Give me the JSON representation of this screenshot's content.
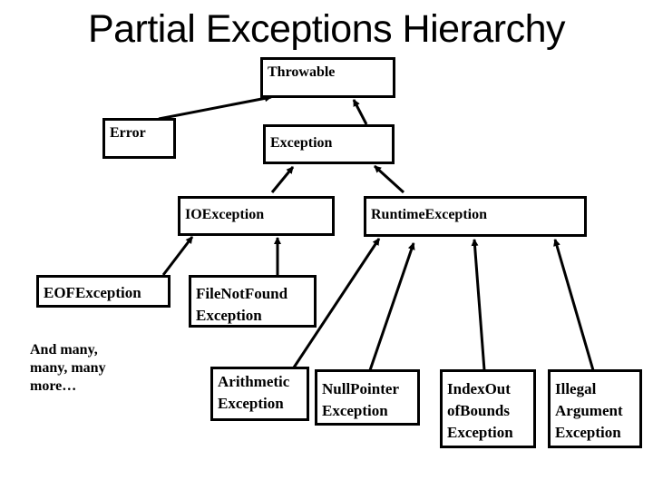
{
  "title": "Partial Exceptions Hierarchy",
  "nodes": {
    "throwable": "Throwable",
    "error": "Error",
    "exception": "Exception",
    "ioexception": "IOException",
    "runtimeexception": "RuntimeException",
    "eofexception": "EOFException",
    "filenotfound": "FileNotFound\nException",
    "arithmetic": "Arithmetic\nException",
    "nullpointer": "NullPointer\nException",
    "indexoutofbounds": "IndexOut\nofBounds\nException",
    "illegalargument": "Illegal\nArgument\nException"
  },
  "note": "And many,\nmany, many\nmore…",
  "edges": [
    {
      "from": "error",
      "to": "throwable"
    },
    {
      "from": "exception",
      "to": "throwable"
    },
    {
      "from": "ioexception",
      "to": "exception"
    },
    {
      "from": "runtimeexception",
      "to": "exception"
    },
    {
      "from": "eofexception",
      "to": "ioexception"
    },
    {
      "from": "filenotfound",
      "to": "ioexception"
    },
    {
      "from": "arithmetic",
      "to": "runtimeexception"
    },
    {
      "from": "nullpointer",
      "to": "runtimeexception"
    },
    {
      "from": "indexoutofbounds",
      "to": "runtimeexception"
    },
    {
      "from": "illegalargument",
      "to": "runtimeexception"
    }
  ]
}
